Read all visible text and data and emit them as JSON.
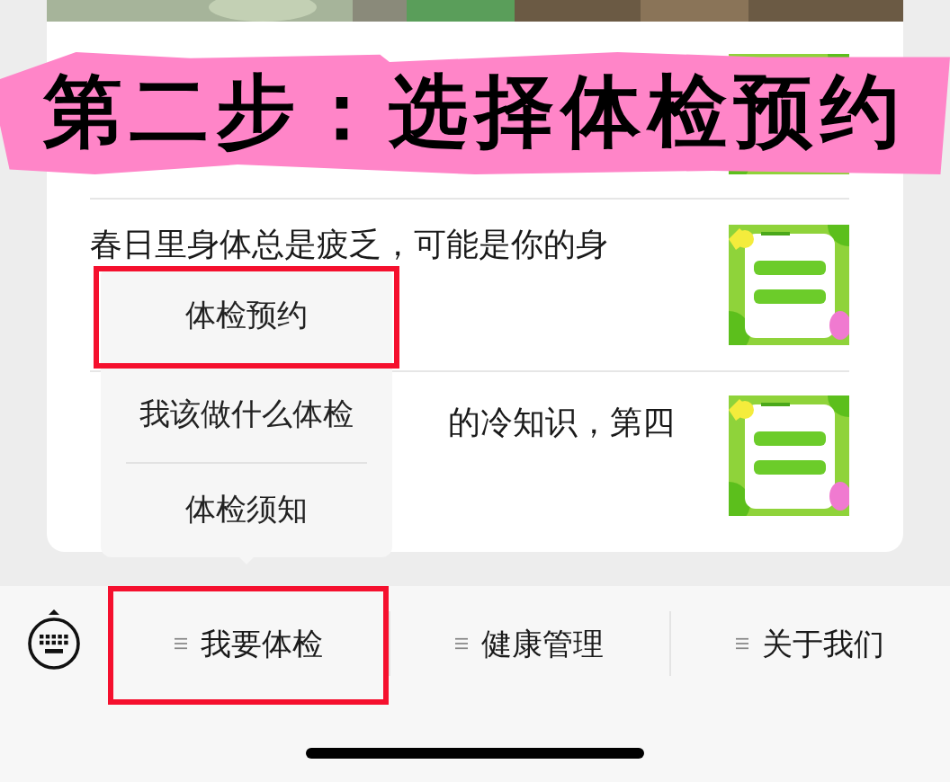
{
  "banner": {
    "text": "第二步：选择体检预约"
  },
  "articles": [
    {
      "thumbnail": {
        "kind": "picture"
      }
    },
    {
      "lines": [
        "春日里身体总是疲乏，可能是你的身"
      ],
      "thumbnail": {
        "kind": "picture"
      }
    },
    {
      "lines": [
        "的冷知识，第四"
      ],
      "thumbnail": {
        "kind": "picture"
      }
    }
  ],
  "submenu": {
    "items": [
      {
        "label": "体检预约",
        "highlighted": true
      },
      {
        "label": "我该做什么体检",
        "highlighted": false
      },
      {
        "label": "体检须知",
        "highlighted": false
      }
    ]
  },
  "menu_bar": {
    "tabs": [
      {
        "label": "我要体检",
        "highlighted": true
      },
      {
        "label": "健康管理",
        "highlighted": false
      },
      {
        "label": "关于我们",
        "highlighted": false
      }
    ]
  }
}
